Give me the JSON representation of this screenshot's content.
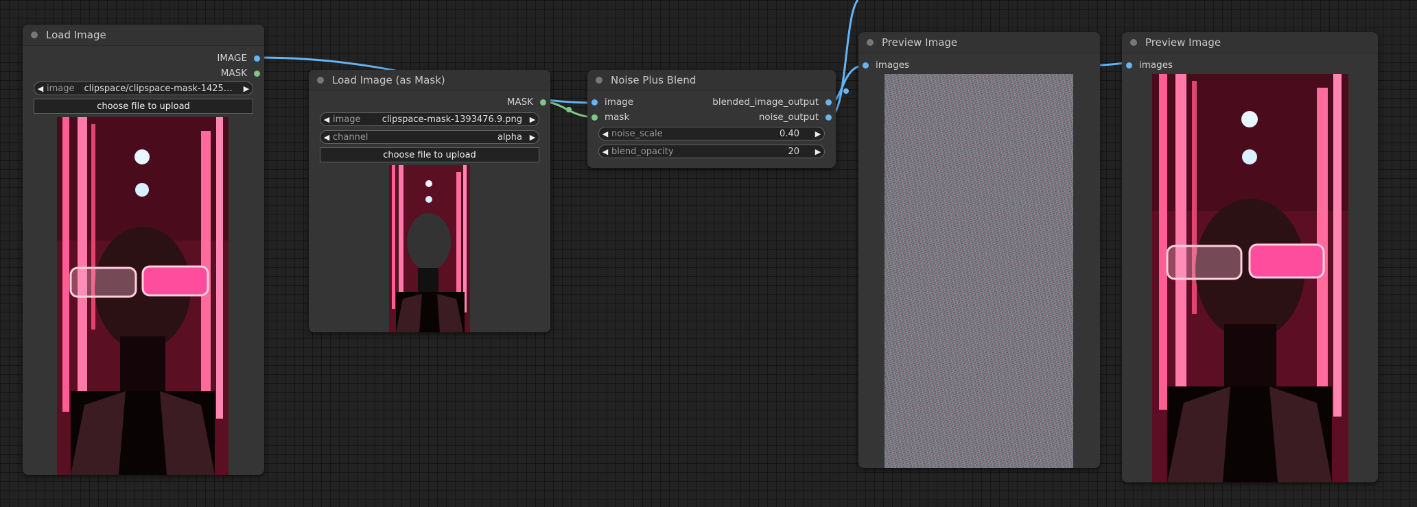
{
  "nodes": {
    "load_image": {
      "title": "Load Image",
      "outputs": {
        "image": "IMAGE",
        "mask": "MASK"
      },
      "image_widget": {
        "label": "image",
        "value": "clipspace/clipspace-mask-142555..."
      },
      "upload_button": "choose file to upload"
    },
    "load_mask": {
      "title": "Load Image (as Mask)",
      "outputs": {
        "mask": "MASK"
      },
      "image_widget": {
        "label": "image",
        "value": "clipspace-mask-1393476.9.png"
      },
      "channel_widget": {
        "label": "channel",
        "value": "alpha"
      },
      "upload_button": "choose file to upload"
    },
    "noise_blend": {
      "title": "Noise Plus Blend",
      "inputs": {
        "image": "image",
        "mask": "mask"
      },
      "outputs": {
        "blended": "blended_image_output",
        "noise": "noise_output"
      },
      "noise_scale": {
        "label": "noise_scale",
        "value": "0.40"
      },
      "blend_opacity": {
        "label": "blend_opacity",
        "value": "20"
      }
    },
    "preview1": {
      "title": "Preview Image",
      "inputs": {
        "images": "images"
      }
    },
    "preview2": {
      "title": "Preview Image",
      "inputs": {
        "images": "images"
      }
    }
  },
  "colors": {
    "canvas": "#222222",
    "node_body": "#353535",
    "image_link": "#64b5f6",
    "mask_link": "#81c784",
    "neon_pink": "#ff4d8d"
  },
  "icons": {
    "arrow_left": "◀",
    "arrow_right": "▶"
  }
}
